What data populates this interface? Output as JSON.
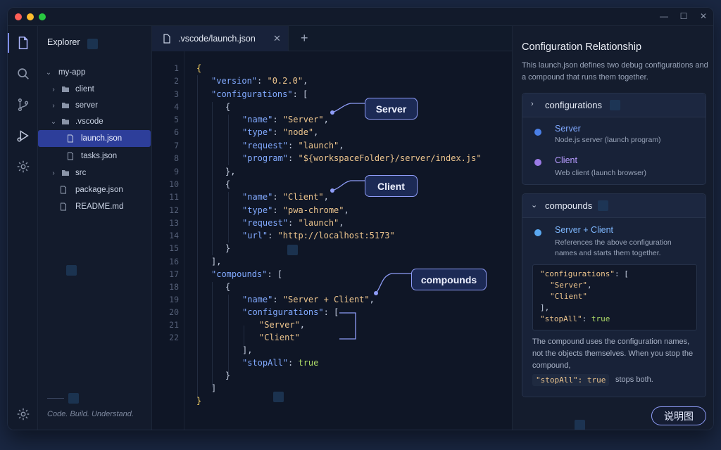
{
  "window": {
    "controls": [
      "minimize-icon",
      "maximize-icon",
      "close-icon"
    ]
  },
  "activity_bar": {
    "icons": [
      "files-icon",
      "search-icon",
      "source-control-icon",
      "run-debug-icon",
      "extensions-icon",
      "settings-gear-icon"
    ]
  },
  "explorer": {
    "title": "Explorer",
    "items": [
      {
        "label": "my-app",
        "type": "folder-open",
        "depth": 0
      },
      {
        "label": "client",
        "type": "folder",
        "depth": 1
      },
      {
        "label": "server",
        "type": "folder",
        "depth": 1
      },
      {
        "label": ".vscode",
        "type": "folder-open",
        "depth": 1
      },
      {
        "label": "launch.json",
        "type": "file",
        "depth": 2,
        "selected": true
      },
      {
        "label": "tasks.json",
        "type": "file",
        "depth": 2
      },
      {
        "label": "src",
        "type": "folder",
        "depth": 1
      },
      {
        "label": "package.json",
        "type": "file",
        "depth": 1
      },
      {
        "label": "README.md",
        "type": "file",
        "depth": 1
      }
    ],
    "footer": "Code. Build. Understand."
  },
  "editor": {
    "tab_label": ".vscode/launch.json",
    "line_numbers": [
      "1",
      "2",
      "3",
      "4",
      "5",
      "6",
      "7",
      "8",
      "9",
      "10",
      "11",
      "12",
      "13",
      "14",
      "15",
      "16",
      "17",
      "18",
      "19",
      "20",
      "21",
      "22"
    ],
    "callouts": {
      "server": "Server",
      "client": "Client",
      "compounds": "compounds"
    }
  },
  "panel": {
    "title": "Configuration Relationship",
    "description": "This launch.json defines two debug configurations and a compound that runs them together.",
    "configurations_card": {
      "header": "configurations",
      "entries": [
        {
          "name": "Server",
          "sub": "Node.js server (launch program)",
          "color": "#4a7fe6"
        },
        {
          "name": "Client",
          "sub": "Web client (launch browser)",
          "color": "#9b7be6"
        }
      ]
    },
    "compounds_card": {
      "header": "compounds",
      "entry_name": "Server + Client",
      "entry_sub": "References the above configuration names and starts them together.",
      "entry_color": "#5aa8f0",
      "note": "The compound uses the configuration names, not the objects themselves. When you stop the compound,",
      "note_code": "\"stopAll\": true",
      "note_tail": "stops both."
    },
    "explain_button": "说明图"
  },
  "colors": {
    "accent": "#8e9cf7",
    "selection": "#2d3e9a",
    "background": "#0f1626"
  }
}
